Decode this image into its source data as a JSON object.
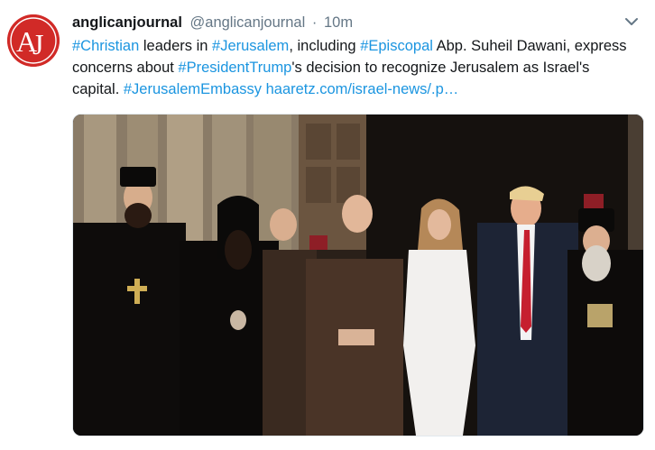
{
  "tweet": {
    "display_name": "anglicanjournal",
    "handle": "@anglicanjournal",
    "separator": "·",
    "time": "10m",
    "text": {
      "hashtag_christian": "#Christian",
      "t1": " leaders in ",
      "hashtag_jerusalem": "#Jerusalem",
      "t2": ", including ",
      "hashtag_episcopal": "#Episcopal",
      "t3": " Abp. Suheil Dawani, express concerns about ",
      "hashtag_president_trump": "#PresidentTrump",
      "t4": "'s decision to recognize Jerusalem as Israel's capital. ",
      "hashtag_jerusalem_embassy": "#JerusalemEmbassy",
      "t5": " ",
      "url": "haaretz.com/israel-news/.p…"
    }
  },
  "avatar": {
    "logo_text": "AJ",
    "background": "#d12a27"
  },
  "colors": {
    "link": "#1b95e0",
    "secondary": "#657786",
    "text": "#14171a"
  },
  "icons": {
    "caret": "chevron-down-icon"
  }
}
